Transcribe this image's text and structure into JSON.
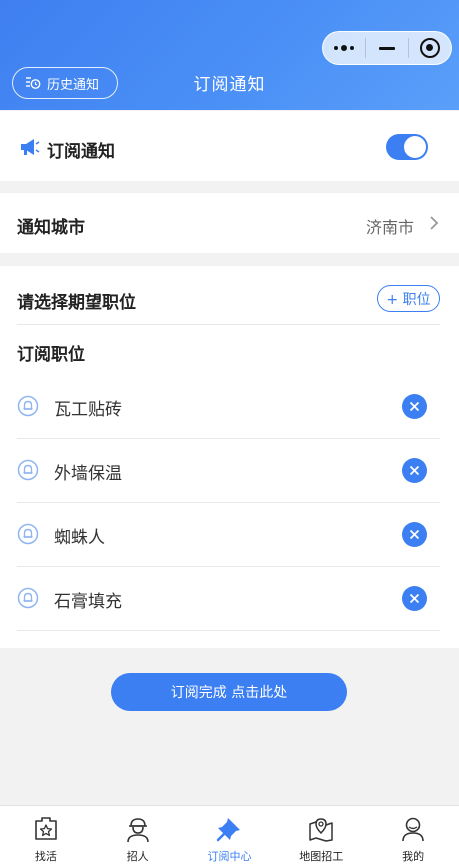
{
  "header": {
    "title": "订阅通知",
    "history_label": "历史通知"
  },
  "subscribe": {
    "label": "订阅通知",
    "enabled": true
  },
  "city": {
    "label": "通知城市",
    "value": "济南市"
  },
  "positions": {
    "select_label": "请选择期望职位",
    "add_label": "+ 职位",
    "subscribed_label": "订阅职位",
    "items": [
      {
        "name": "瓦工贴砖"
      },
      {
        "name": "外墙保温"
      },
      {
        "name": "蜘蛛人"
      },
      {
        "name": "石膏填充"
      }
    ]
  },
  "done_label": "订阅完成 点击此处",
  "tabbar": [
    {
      "label": "找活",
      "icon": "star-box-icon"
    },
    {
      "label": "招人",
      "icon": "worker-helmet-icon"
    },
    {
      "label": "订阅中心",
      "icon": "pin-icon",
      "active": true
    },
    {
      "label": "地图招工",
      "icon": "map-icon"
    },
    {
      "label": "我的",
      "icon": "user-icon"
    }
  ],
  "colors": {
    "accent": "#3b7ff2",
    "header_gradient_start": "#3f7ff0",
    "header_gradient_end": "#5a9ff9"
  }
}
